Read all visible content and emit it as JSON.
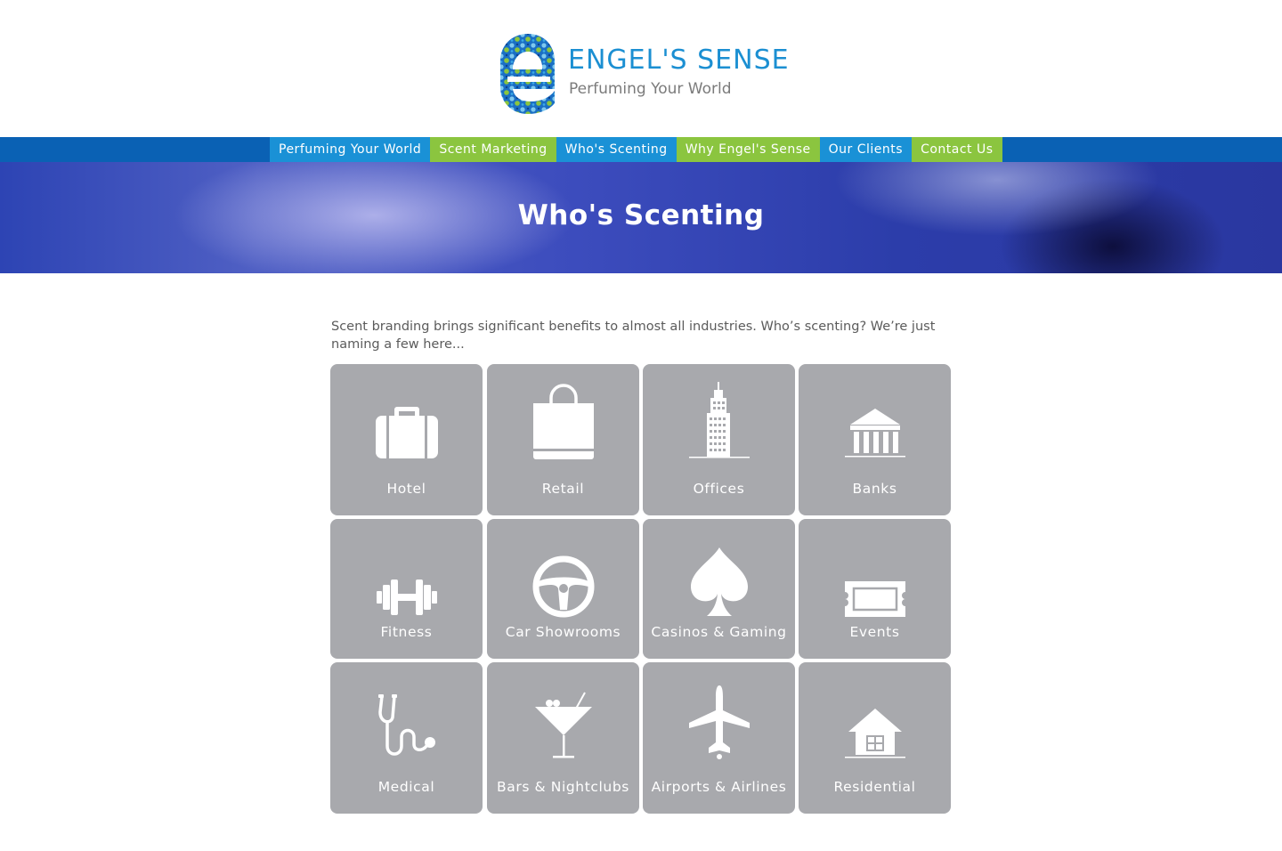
{
  "brand": {
    "name": "ENGEL'S SENSE",
    "tagline": "Perfuming Your World",
    "colors": {
      "blue": "#1a91d6",
      "green": "#8bc53f",
      "navbar": "#0a61b4",
      "tile": "#a8a9ad"
    }
  },
  "nav": {
    "items": [
      {
        "label": "Perfuming Your World",
        "style": "blue"
      },
      {
        "label": "Scent Marketing",
        "style": "green"
      },
      {
        "label": "Who's Scenting",
        "style": "blue"
      },
      {
        "label": "Why Engel's Sense",
        "style": "green"
      },
      {
        "label": "Our Clients",
        "style": "blue"
      },
      {
        "label": "Contact Us",
        "style": "green"
      }
    ]
  },
  "banner": {
    "title": "Who's Scenting"
  },
  "intro": "Scent branding brings significant benefits to almost all industries. Who’s scenting? We’re just naming a few here...",
  "industries": [
    {
      "label": "Hotel",
      "icon": "suitcase-icon"
    },
    {
      "label": "Retail",
      "icon": "shopping-bag-icon"
    },
    {
      "label": "Offices",
      "icon": "skyscraper-icon"
    },
    {
      "label": "Banks",
      "icon": "bank-icon"
    },
    {
      "label": "Fitness",
      "icon": "dumbbell-icon"
    },
    {
      "label": "Car Showrooms",
      "icon": "steering-wheel-icon"
    },
    {
      "label": "Casinos & Gaming",
      "icon": "spade-icon"
    },
    {
      "label": "Events",
      "icon": "ticket-icon"
    },
    {
      "label": "Medical",
      "icon": "stethoscope-icon"
    },
    {
      "label": "Bars & Nightclubs",
      "icon": "cocktail-icon"
    },
    {
      "label": "Airports & Airlines",
      "icon": "airplane-icon"
    },
    {
      "label": "Residential",
      "icon": "house-icon"
    }
  ]
}
